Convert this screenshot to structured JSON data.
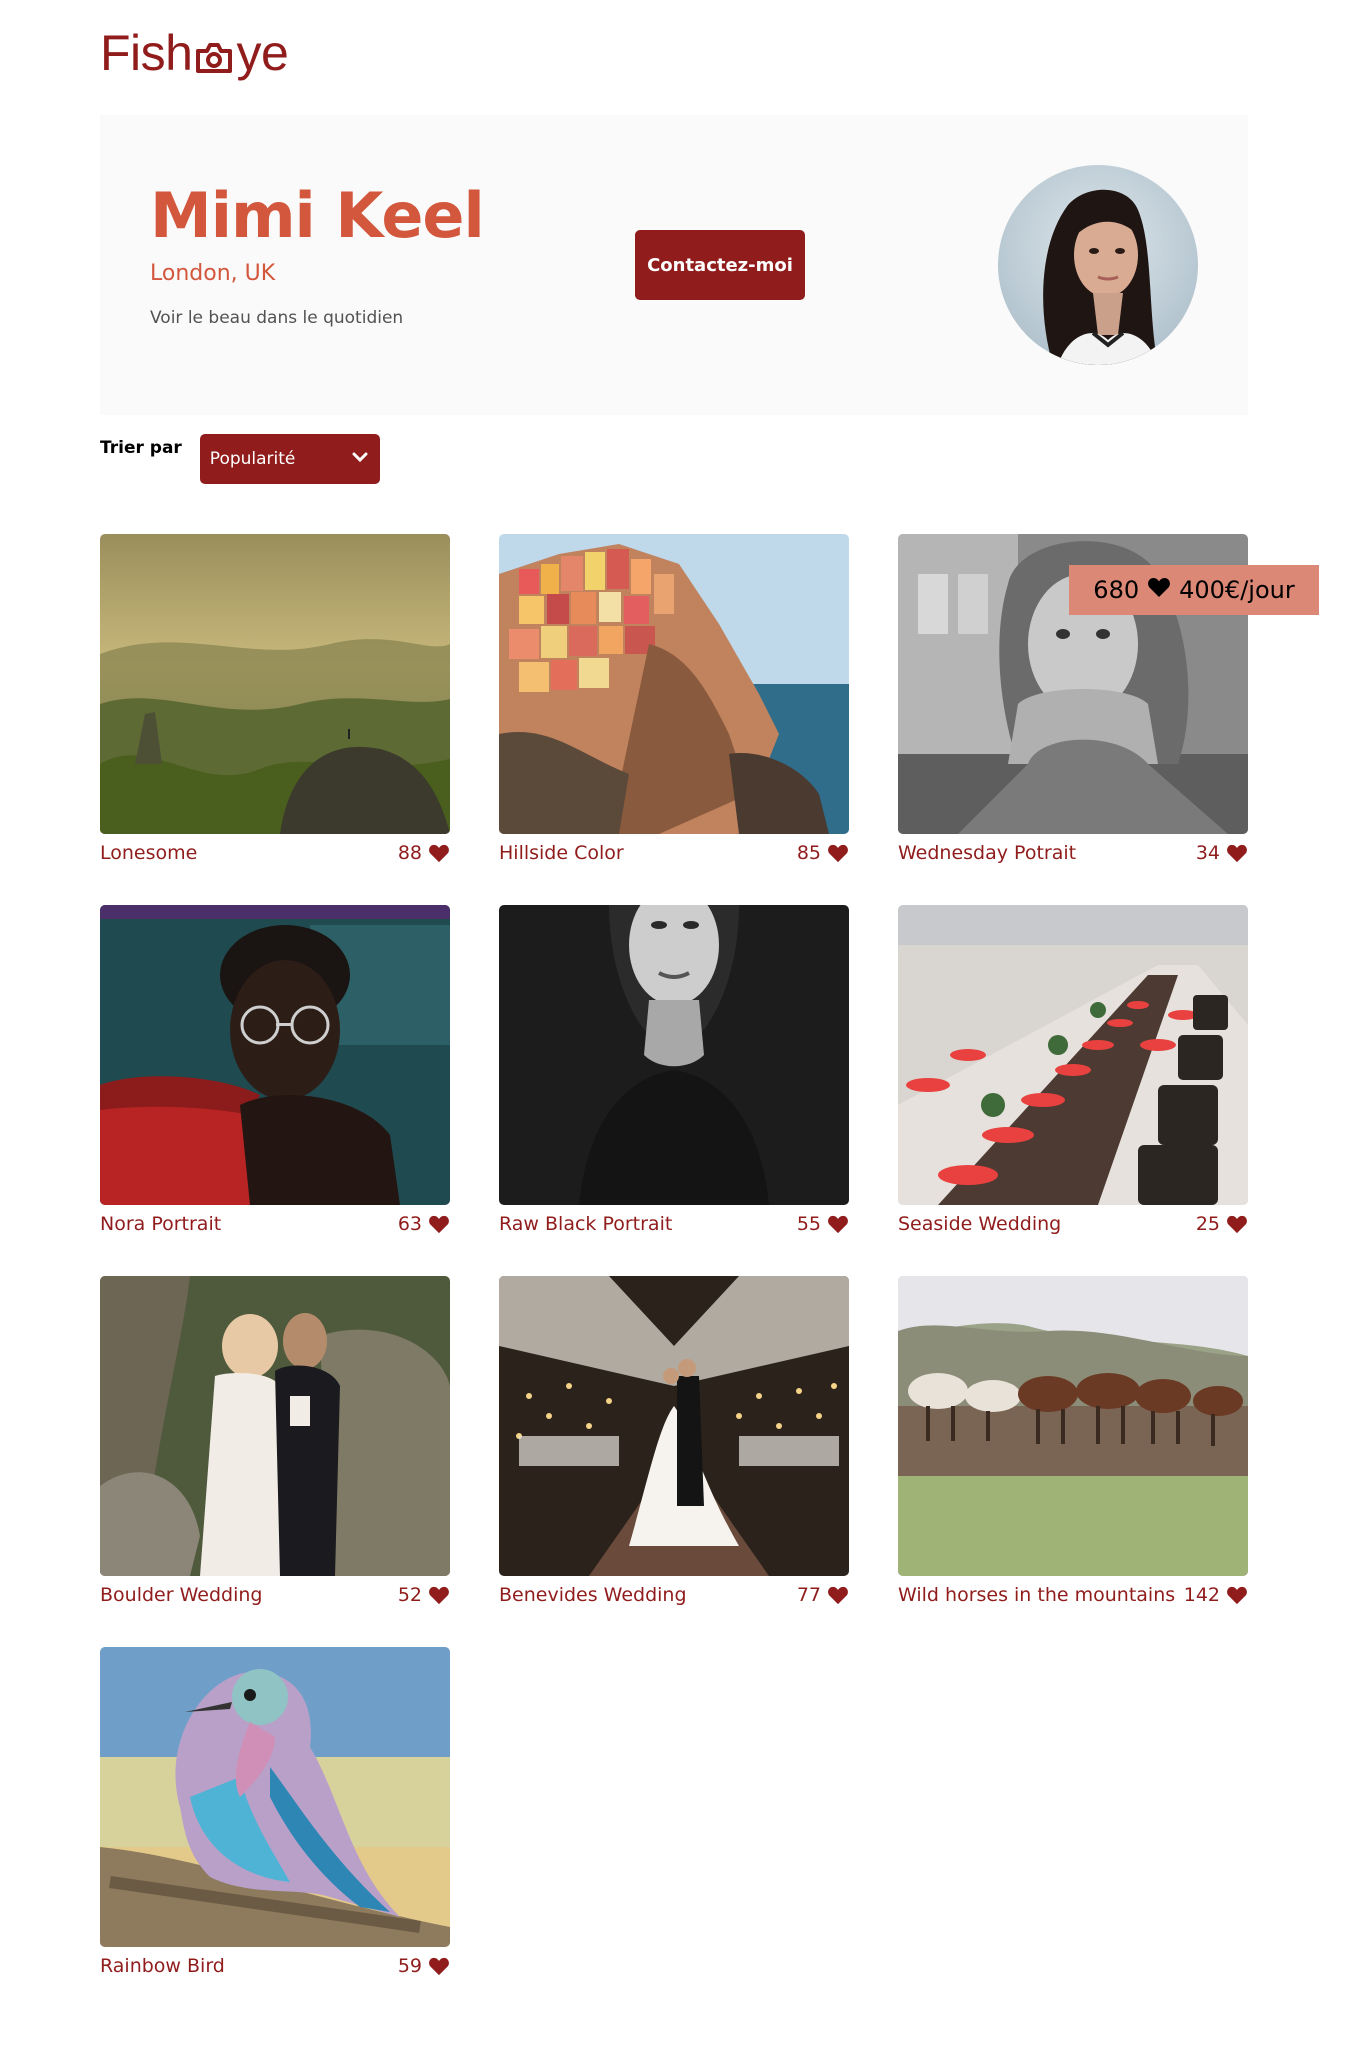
{
  "header": {
    "logo_left": "Fish",
    "logo_right": "ye",
    "logo_icon": "camera-icon",
    "brand_color": "#901c1c"
  },
  "photographer": {
    "name": "Mimi Keel",
    "location": "London, UK",
    "tagline": "Voir le beau dans le quotidien",
    "contact_label": "Contactez-moi",
    "accent_color": "#d3573c"
  },
  "sort": {
    "label": "Trier par",
    "selected": "Popularité",
    "icon": "chevron-down-icon"
  },
  "media": [
    {
      "title": "Lonesome",
      "likes": "88"
    },
    {
      "title": "Hillside Color",
      "likes": "85"
    },
    {
      "title": "Wednesday Potrait",
      "likes": "34"
    },
    {
      "title": "Nora Portrait",
      "likes": "63"
    },
    {
      "title": "Raw Black Portrait",
      "likes": "55"
    },
    {
      "title": "Seaside Wedding",
      "likes": "25"
    },
    {
      "title": "Boulder Wedding",
      "likes": "52"
    },
    {
      "title": "Benevides Wedding",
      "likes": "77"
    },
    {
      "title": "Wild horses in the mountains",
      "likes": "142"
    },
    {
      "title": "Rainbow Bird",
      "likes": "59"
    }
  ],
  "stats": {
    "total_likes": "680",
    "price": "400€/jour",
    "background": "#db8876"
  }
}
